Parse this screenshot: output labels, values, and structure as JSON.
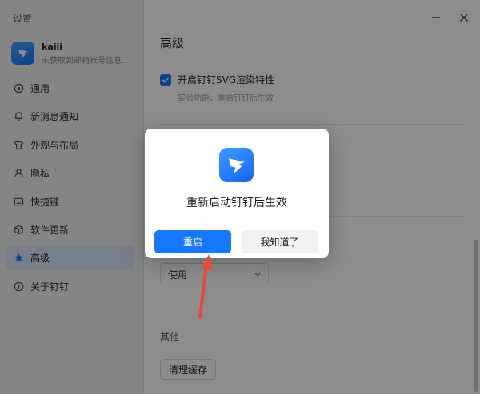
{
  "window": {
    "title": "设置"
  },
  "profile": {
    "name": "kaili",
    "subtitle": "未获取到邮箱帐号信息..."
  },
  "sidebar": {
    "items": [
      {
        "label": "通用",
        "icon": "general-icon"
      },
      {
        "label": "新消息通知",
        "icon": "bell-icon"
      },
      {
        "label": "外观与布局",
        "icon": "shirt-icon"
      },
      {
        "label": "隐私",
        "icon": "user-icon"
      },
      {
        "label": "快捷键",
        "icon": "keyboard-icon"
      },
      {
        "label": "软件更新",
        "icon": "cube-icon"
      },
      {
        "label": "高级",
        "icon": "star-icon",
        "active": true
      },
      {
        "label": "关于钉钉",
        "icon": "info-icon"
      }
    ]
  },
  "main": {
    "section_title": "高级",
    "svg_option": {
      "label": "开启钉钉SVG渲染特性",
      "checked": true,
      "hint": "实验功能，重启钉钉后生效"
    },
    "select": {
      "value": "使用"
    },
    "other_label": "其他",
    "clear_cache_label": "清理缓存"
  },
  "dialog": {
    "message": "重新启动钉钉后生效",
    "primary_label": "重启",
    "secondary_label": "我知道了"
  },
  "colors": {
    "accent": "#1677ff",
    "annotation_arrow": "#e8473f"
  }
}
